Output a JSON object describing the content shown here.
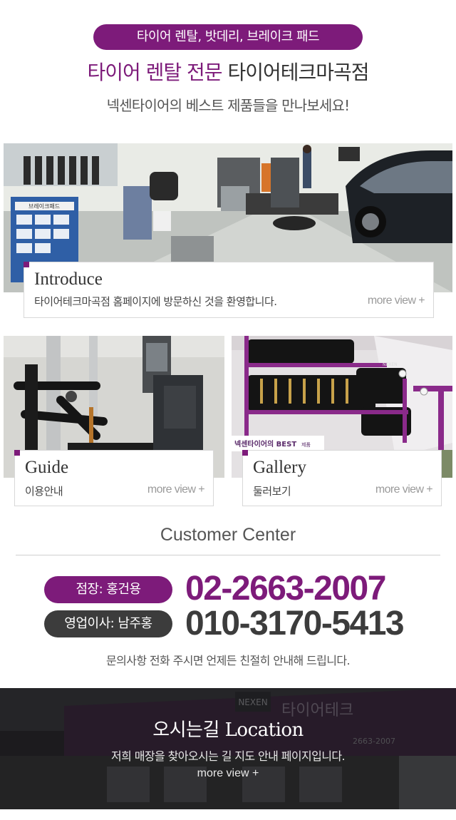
{
  "header": {
    "services_pill": "타이어 렌탈, 밧데리, 브레이크 패드",
    "headline_accent": "타이어 렌탈 전문",
    "headline_rest": " 타이어테크마곡점",
    "subline": "넥센타이어의 베스트 제품들을 만나보세요!"
  },
  "cards": {
    "introduce": {
      "title": "Introduce",
      "desc": "타이어테크마곡점 홈페이지에 방문하신 것을 환영합니다.",
      "more": "more view +"
    },
    "guide": {
      "title": "Guide",
      "desc": "이용안내",
      "more": "more view +"
    },
    "gallery": {
      "title": "Gallery",
      "desc": "둘러보기",
      "more": "more view +"
    }
  },
  "photo_text": {
    "shop_sign": "넥센타이어의 BEST",
    "shop_sign_small": "제품",
    "rack_label": "NEXEN",
    "building_sign": "타이어테크",
    "building_logo": "NEXEN",
    "building_phone": "2663-2007",
    "intro_shelf_sign": "브레이크패드"
  },
  "customer_center": {
    "title": "Customer Center",
    "contacts": [
      {
        "label": "점장: 홍건용",
        "phone": "02-2663-2007",
        "color": "#7d1b7a"
      },
      {
        "label": "영업이사: 남주홍",
        "phone": "010-3170-5413",
        "color": "#3c3c3c"
      }
    ],
    "note": "문의사항 전화 주시면 언제든 친절히 안내해 드립니다."
  },
  "location": {
    "title": "오시는길 Location",
    "desc": "저희 매장을 찾아오시는 길 지도 안내 페이지입니다.",
    "more": "more view +"
  },
  "colors": {
    "brand": "#7d1b7a",
    "dark": "#3c3c3c"
  }
}
